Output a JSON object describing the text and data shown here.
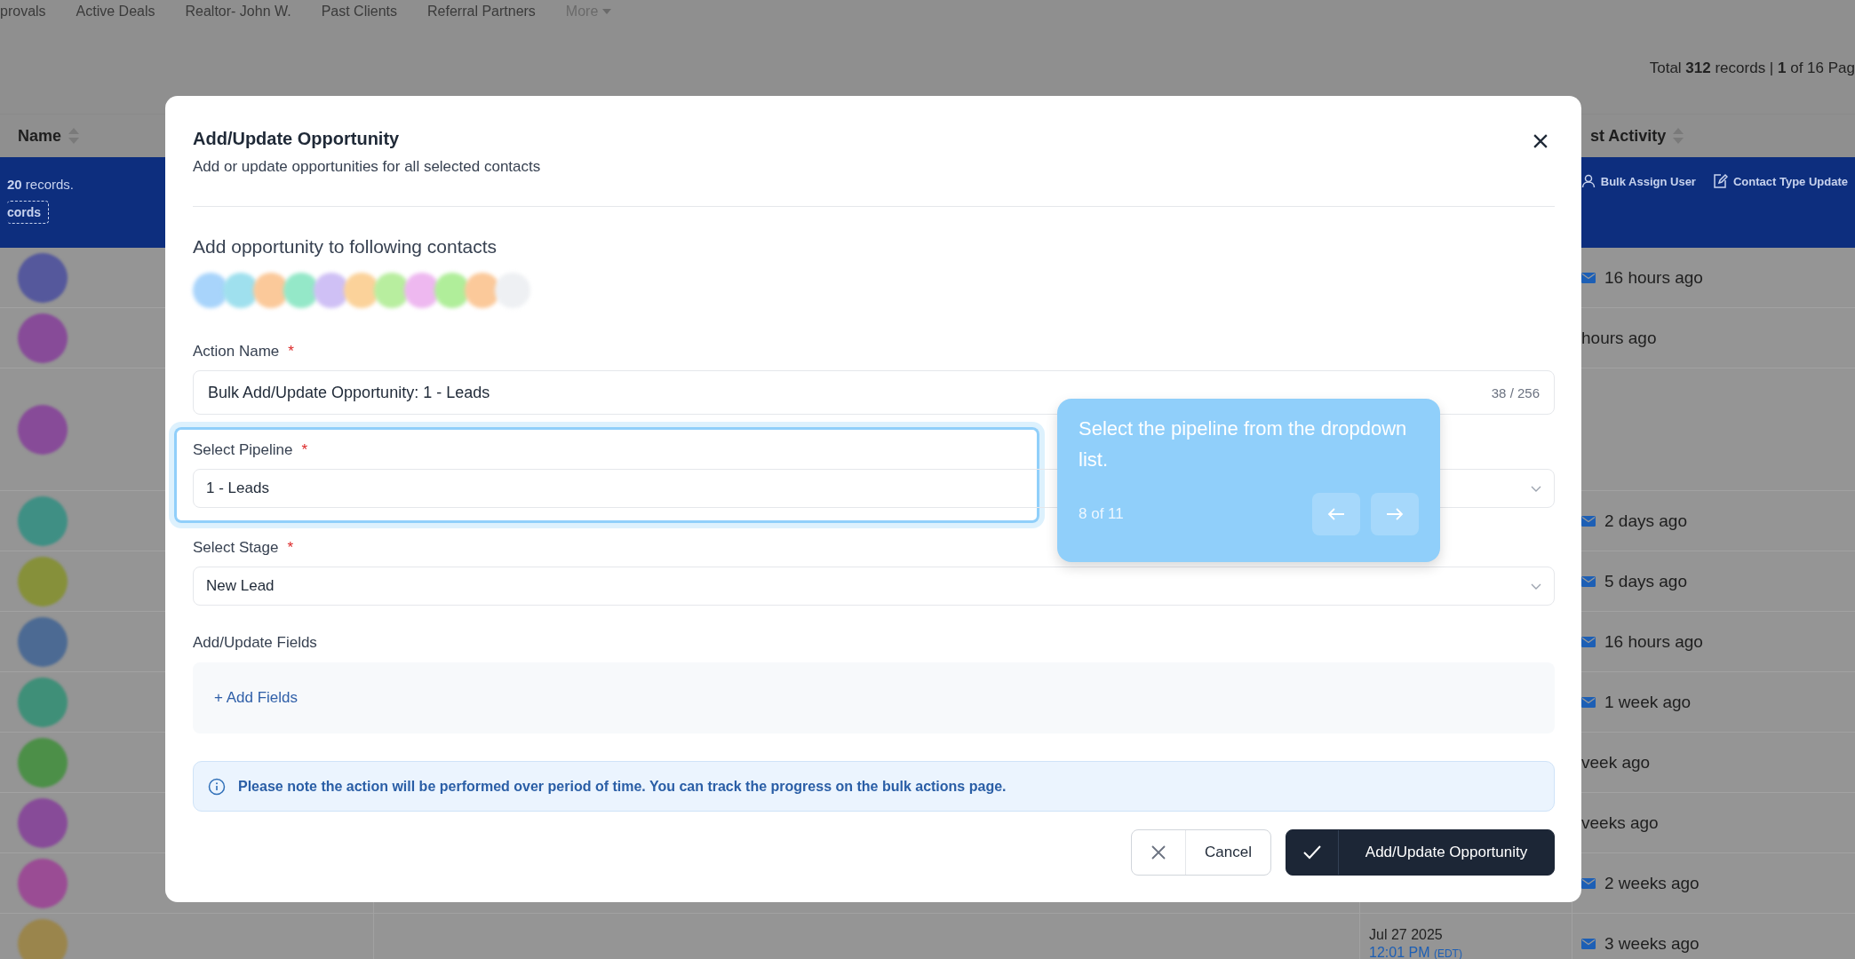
{
  "nav_tabs": [
    "provals",
    "Active Deals",
    "Realtor- John W.",
    "Past Clients",
    "Referral Partners"
  ],
  "more_menu": "More",
  "records_summary": "Total **312** records | **1** of 16 Pag",
  "table": {
    "columns": [
      "Name",
      "st Activity"
    ],
    "selection_banner": {
      "text": "**20** records.",
      "button": "cords"
    },
    "bulk_actions": [
      {
        "label": "Bulk Assign User",
        "kind": "user"
      },
      {
        "label": "Contact Type Update",
        "kind": "edit"
      }
    ],
    "rows": [
      {
        "kind": "single",
        "color": "#55589c",
        "last_activity": "16 hours ago",
        "email_icon": true
      },
      {
        "kind": "single",
        "color": "#874b98",
        "last_activity": "hours ago",
        "email_icon": false
      },
      {
        "kind": "double",
        "color": "#874b98",
        "email_icon": false
      },
      {
        "kind": "single",
        "color": "#3f8f84",
        "last_activity": "2 days ago",
        "email_icon": true
      },
      {
        "kind": "single",
        "color": "#86903a",
        "last_activity": "5 days ago",
        "email_icon": true
      },
      {
        "kind": "single",
        "color": "#4c6a93",
        "last_activity": "16 hours ago",
        "email_icon": true
      },
      {
        "kind": "single",
        "color": "#3f8f78",
        "last_activity": "1 week ago",
        "email_icon": true
      },
      {
        "kind": "single",
        "color": "#4c8f48",
        "last_activity": "veek ago",
        "email_icon": false
      },
      {
        "kind": "single",
        "color": "#874b98",
        "last_activity": "veeks ago",
        "email_icon": false
      },
      {
        "kind": "single",
        "color": "#9a4c94",
        "last_activity": "2 weeks ago",
        "email_icon": true
      },
      {
        "kind": "single",
        "color": "#9a854c",
        "date": "Jul 27 2025",
        "time": "12:01 PM",
        "zone": "(EDT)",
        "last_activity": "3 weeks ago",
        "email_icon": true
      }
    ]
  },
  "modal": {
    "title": "Add/Update Opportunity",
    "subtitle": "Add or update opportunities for all selected contacts",
    "contacts_heading": "Add opportunity to following contacts",
    "contact_avatars": [
      {
        "color": "#a8d4fb"
      },
      {
        "color": "#9fe0ee"
      },
      {
        "color": "#fbc99a"
      },
      {
        "color": "#94e8c8"
      },
      {
        "color": "#cfc0f5"
      },
      {
        "color": "#fbd29a"
      },
      {
        "color": "#b8ee9f"
      },
      {
        "color": "#eeb8f0"
      },
      {
        "color": "#b0ee9a"
      },
      {
        "color": "#fbc99a"
      },
      {
        "color": "#eef0f3"
      }
    ],
    "action_name": {
      "label": "Action Name",
      "required_mark": "*",
      "value": "Bulk Add/Update Opportunity: 1 - Leads",
      "counter": "38 / 256"
    },
    "pipeline": {
      "label": "Select Pipeline",
      "required_mark": "*",
      "value": "1 - Leads"
    },
    "stage": {
      "label": "Select Stage",
      "required_mark": "*",
      "value": "New Lead"
    },
    "custom_fields": {
      "label": "Add/Update Fields",
      "add_button": "+ Add Fields"
    },
    "notice": "Please note the action will be performed over period of time. You can track the progress on the bulk actions page.",
    "buttons": [
      {
        "label": "Cancel",
        "kind": "secondary"
      },
      {
        "label": "Add/Update Opportunity",
        "kind": "primary"
      }
    ]
  },
  "tour_tooltip": {
    "text": "Select the pipeline from the dropdown list.",
    "step": "8 of 11"
  }
}
